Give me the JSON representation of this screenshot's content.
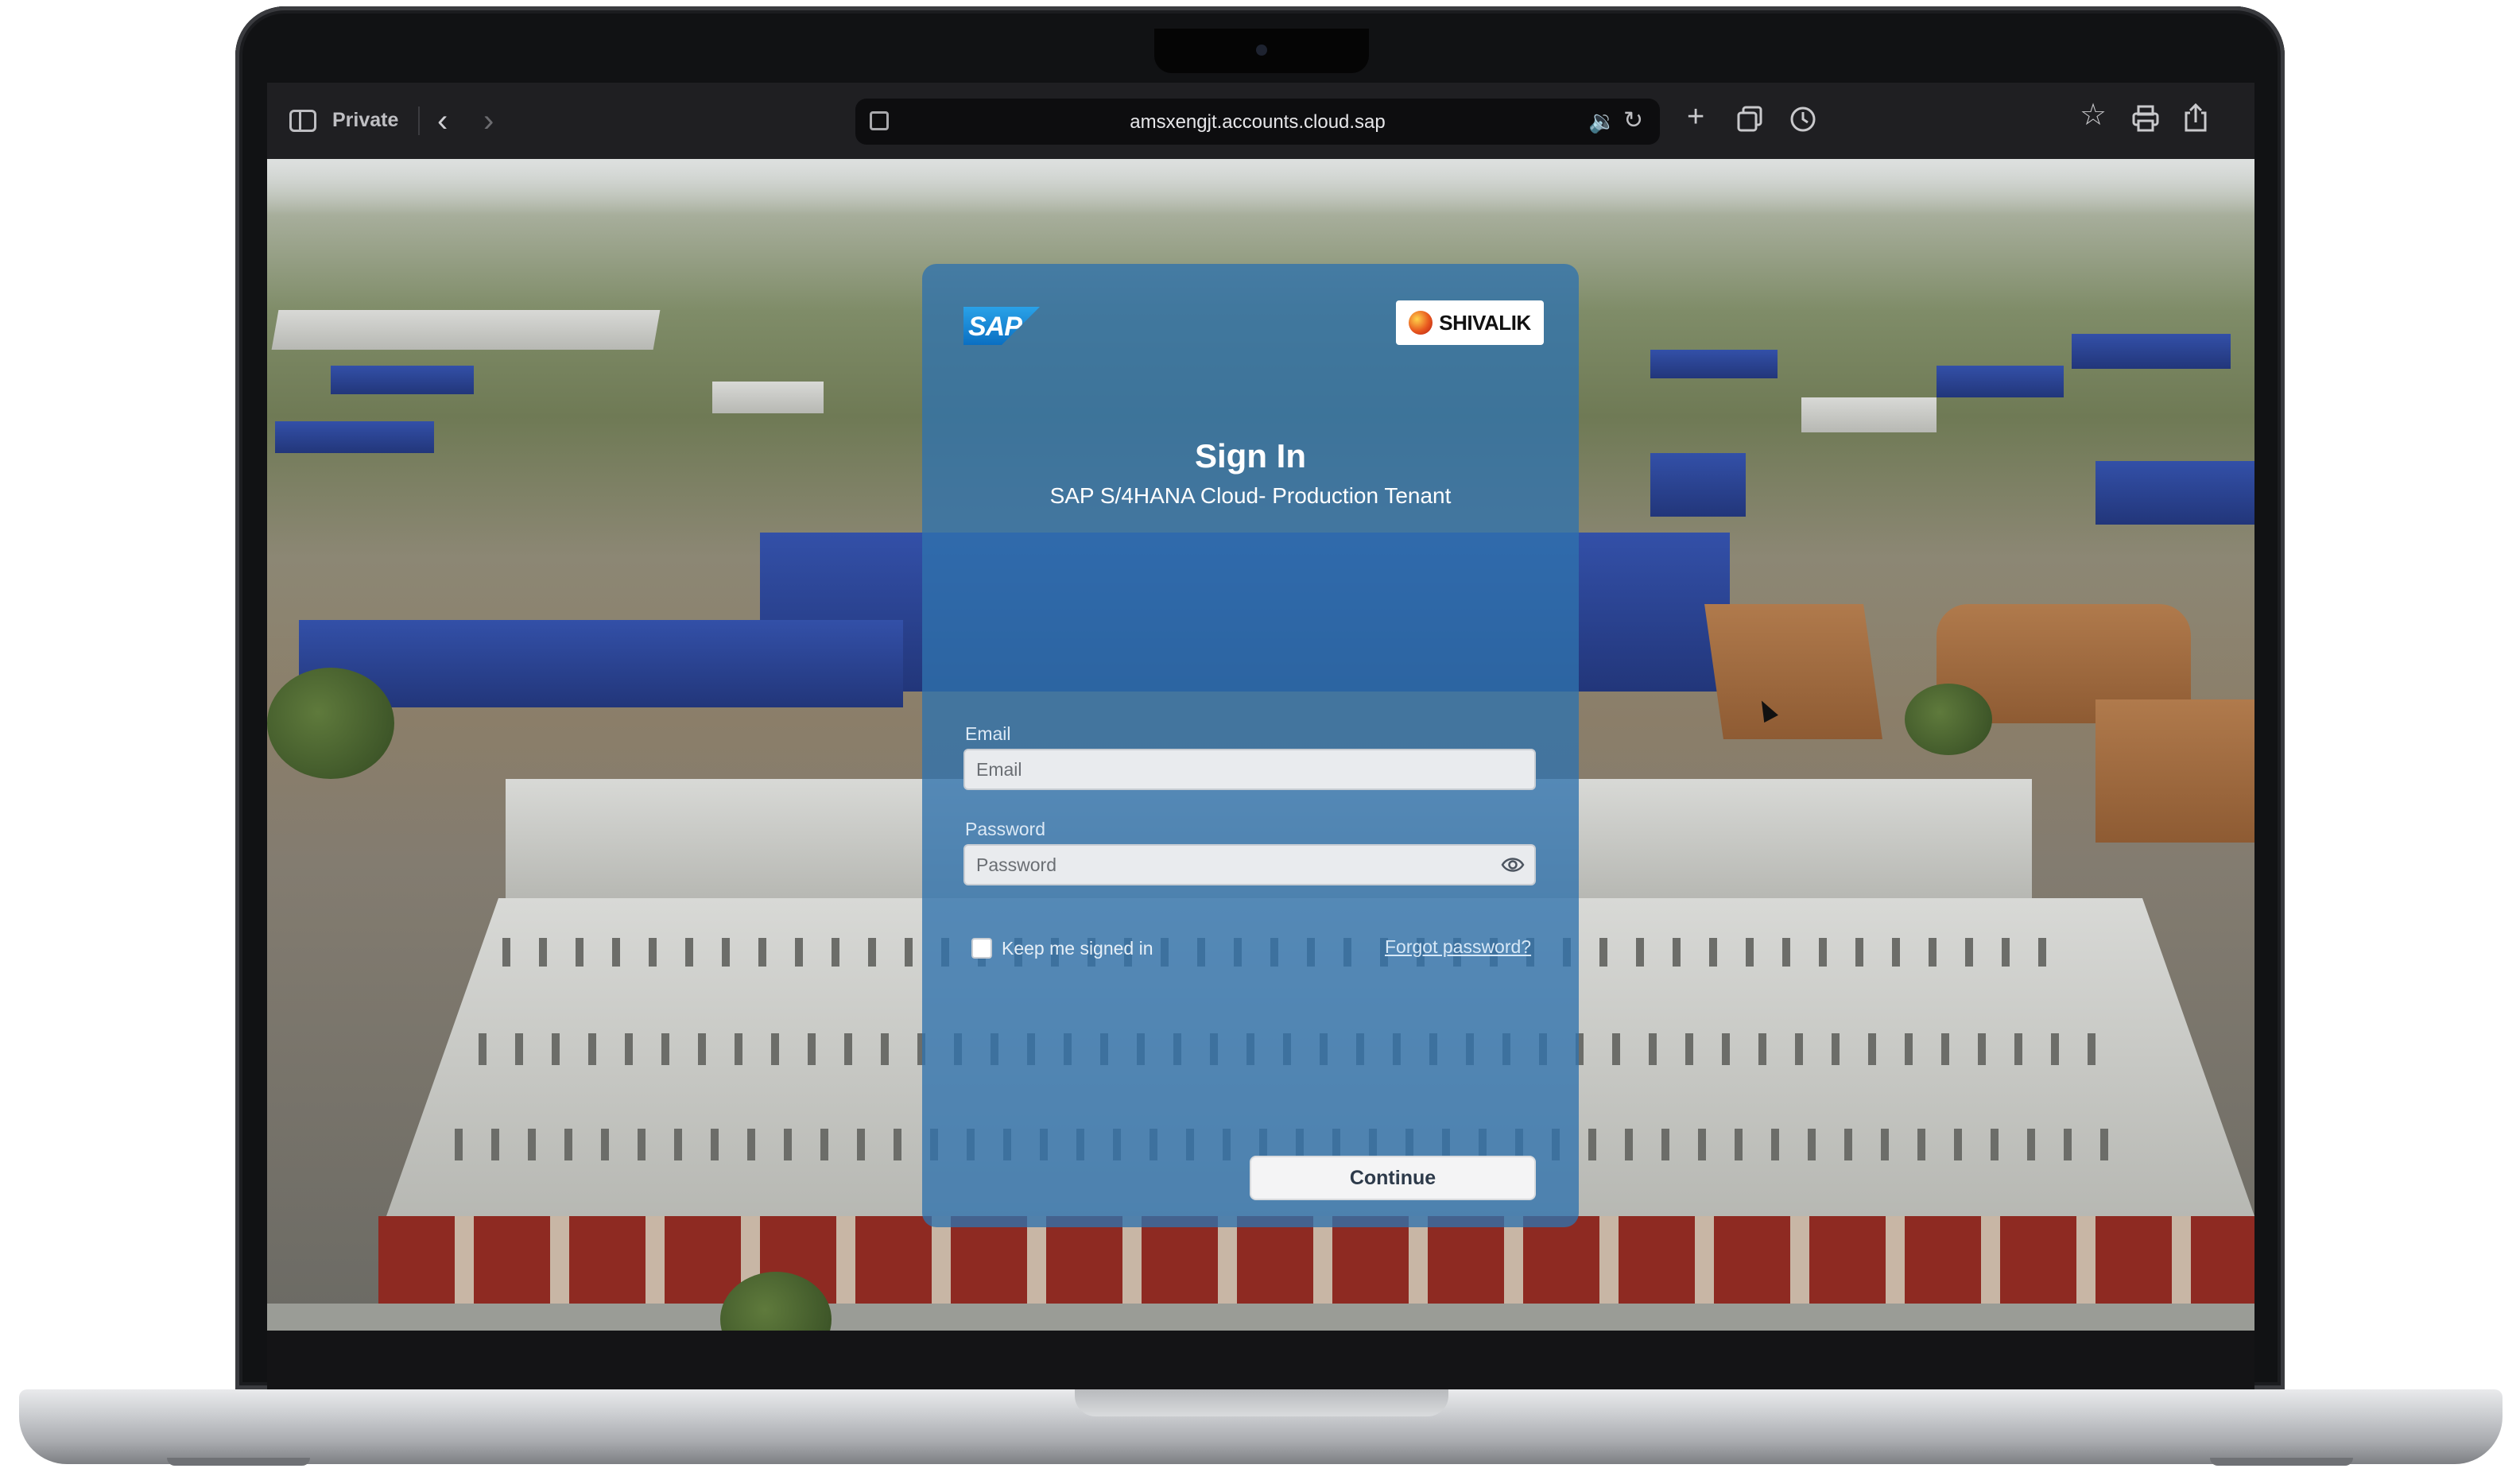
{
  "browser": {
    "private_label": "Private",
    "url": "amsxengjt.accounts.cloud.sap",
    "icons": [
      "sidebar-icon",
      "back-icon",
      "forward-icon",
      "site-settings-icon",
      "speaker-icon",
      "reload-icon",
      "new-tab-icon",
      "tabs-overview-icon",
      "history-icon",
      "bookmark-star-icon",
      "print-icon",
      "share-icon"
    ]
  },
  "login": {
    "sap_logo": "SAP",
    "brand_logo": "SHIVALIK",
    "title": "Sign In",
    "subtitle": "SAP S/4HANA Cloud- Production Tenant",
    "email_label": "Email",
    "email_placeholder": "Email",
    "password_label": "Password",
    "password_placeholder": "Password",
    "keep_signed_in": "Keep me signed in",
    "forgot_password": "Forgot password?",
    "continue_label": "Continue"
  },
  "colors": {
    "panel": "#2f72ad",
    "toolbar": "#1f1f22",
    "speaker_accent": "#2f8bf3"
  }
}
